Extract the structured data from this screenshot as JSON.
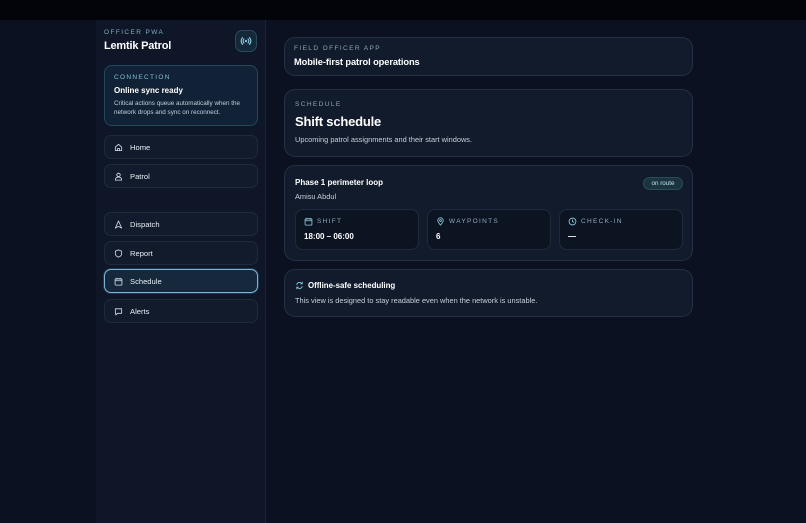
{
  "app": {
    "kicker": "OFFICER PWA",
    "title": "Lemtik Patrol"
  },
  "connection": {
    "kicker": "CONNECTION",
    "title": "Online sync ready",
    "text": "Critical actions queue automatically when the network drops and sync on reconnect."
  },
  "nav": {
    "items": [
      {
        "label": "Home",
        "icon": "home-icon"
      },
      {
        "label": "Patrol",
        "icon": "patrol-icon"
      },
      {
        "label": "Dispatch",
        "icon": "dispatch-icon"
      },
      {
        "label": "Report",
        "icon": "shield-icon"
      },
      {
        "label": "Schedule",
        "icon": "calendar-icon",
        "active": true
      },
      {
        "label": "Alerts",
        "icon": "message-icon"
      }
    ]
  },
  "header": {
    "kicker": "FIELD OFFICER APP",
    "title": "Mobile-first patrol operations"
  },
  "schedule": {
    "kicker": "SCHEDULE",
    "title": "Shift schedule",
    "subtitle": "Upcoming patrol assignments and their start windows."
  },
  "assignment": {
    "title": "Phase 1 perimeter loop",
    "officer": "Amisu Abdul",
    "status": "on route",
    "stats": [
      {
        "label": "SHIFT",
        "value": "18:00 – 06:00",
        "icon": "calendar-icon"
      },
      {
        "label": "WAYPOINTS",
        "value": "6",
        "icon": "location-pin-icon"
      },
      {
        "label": "CHECK-IN",
        "value": "—",
        "icon": "clock-icon"
      }
    ]
  },
  "offline": {
    "title": "Offline-safe scheduling",
    "text": "This view is designed to stay readable even when the network is unstable."
  },
  "colors": {
    "background": "#0b1120",
    "accent": "#7cb5d3",
    "card": "#121b2b"
  }
}
